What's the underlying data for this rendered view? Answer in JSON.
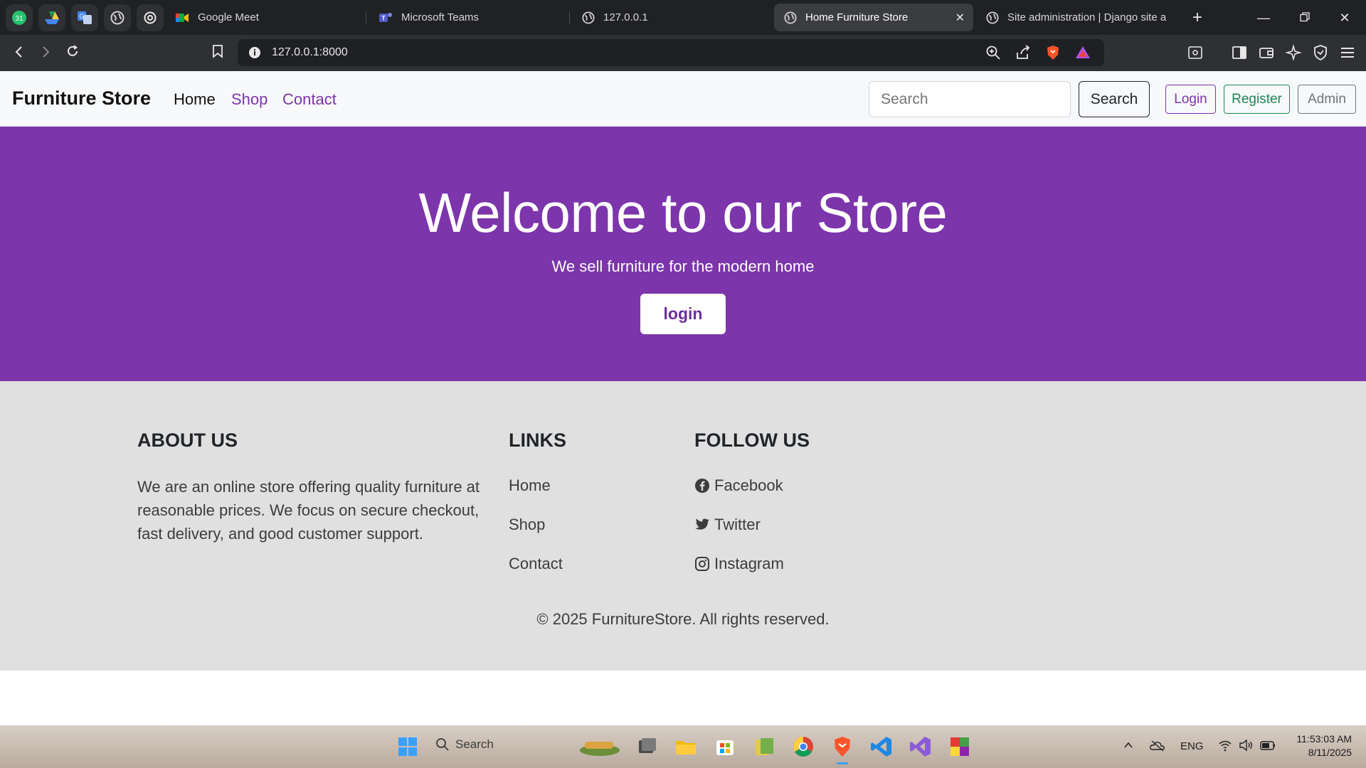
{
  "browser": {
    "tabs": [
      {
        "title": "Google Meet",
        "active": false
      },
      {
        "title": "Microsoft Teams",
        "active": false
      },
      {
        "title": "127.0.0.1",
        "active": false
      },
      {
        "title": "Home Furniture Store",
        "active": true
      },
      {
        "title": "Site administration | Django site a",
        "active": false
      }
    ],
    "url": "127.0.0.1:8000",
    "new_tab": "+",
    "close_glyph": "✕"
  },
  "nav": {
    "brand": "Furniture Store",
    "links": [
      "Home",
      "Shop",
      "Contact"
    ],
    "search_placeholder": "Search",
    "search_button": "Search",
    "login_button": "Login",
    "register_button": "Register",
    "admin_button": "Admin",
    "colors": {
      "link": "#7c35ab",
      "login": "#7c35ab",
      "register": "#198754",
      "admin": "#6c757d"
    }
  },
  "hero": {
    "title": "Welcome to our Store",
    "subtitle": "We sell furniture for the modern home",
    "button": "login",
    "background": "#7c35ab"
  },
  "footer": {
    "about_heading": "ABOUT US",
    "about_text": "We are an online store offering quality furniture at reasonable prices. We focus on secure checkout, fast delivery, and good customer support.",
    "links_heading": "LINKS",
    "links": [
      "Home",
      "Shop",
      "Contact"
    ],
    "follow_heading": "FOLLOW US",
    "social": [
      {
        "label": "Facebook",
        "icon": "facebook-icon"
      },
      {
        "label": "Twitter",
        "icon": "twitter-icon"
      },
      {
        "label": "Instagram",
        "icon": "instagram-icon"
      }
    ],
    "copyright": "© 2025 FurnitureStore. All rights reserved."
  },
  "taskbar": {
    "search_label": "Search",
    "language": "ENG",
    "time": "11:53:03 AM",
    "date": "8/11/2025"
  }
}
